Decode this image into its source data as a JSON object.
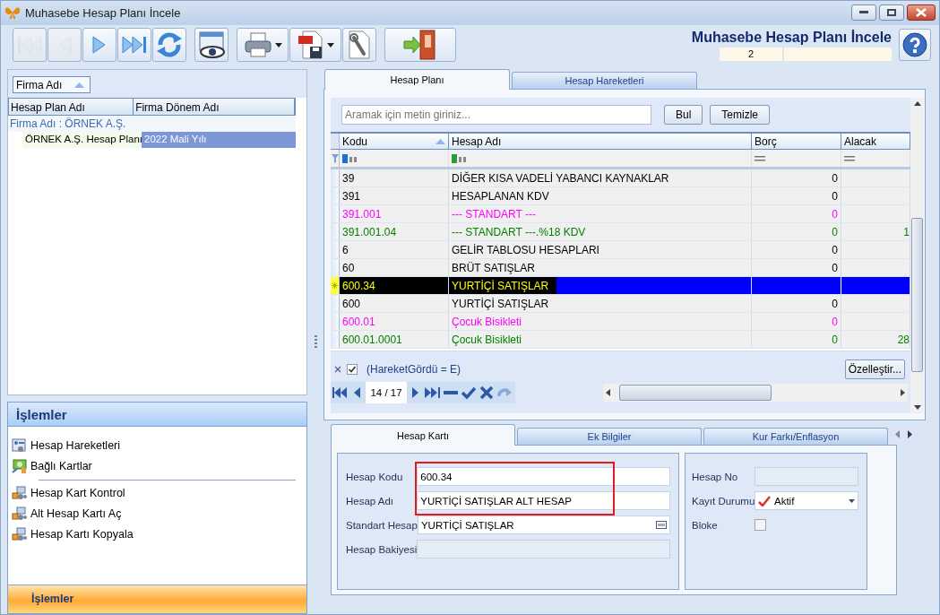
{
  "window": {
    "title": "Muhasebe Hesap Planı İncele"
  },
  "toolbar": [
    {
      "kind": "first",
      "disabled": true
    },
    {
      "kind": "prev",
      "disabled": true
    },
    {
      "kind": "next",
      "disabled": false
    },
    {
      "kind": "last",
      "disabled": false
    },
    {
      "kind": "refresh",
      "disabled": false
    },
    {
      "kind": "preview",
      "disabled": false
    },
    {
      "kind": "print",
      "disabled": false,
      "dropdown": true
    },
    {
      "kind": "pdf",
      "disabled": false,
      "dropdown": true
    },
    {
      "kind": "tools",
      "disabled": false
    },
    {
      "kind": "exit",
      "disabled": false
    }
  ],
  "header": {
    "title": "Muhasebe Hesap Planı İncele",
    "fields": [
      "2"
    ]
  },
  "plan_list": {
    "group_by": "Firma Adı",
    "columns": [
      "Hesap Plan Adı",
      "Firma Dönem Adı"
    ],
    "groups": [
      {
        "label": "Firma Adı : ÖRNEK A.Ş.",
        "children": [
          {
            "cells": [
              "ÖRNEK A.Ş. Hesap Planı",
              "2022 Mali Yılı"
            ],
            "selected": true
          }
        ]
      }
    ]
  },
  "tasks": {
    "title": "İşlemler",
    "items": [
      {
        "kind": "item",
        "label": "Hesap Hareketleri"
      },
      {
        "kind": "item",
        "label": "Bağlı Kartlar"
      },
      {
        "kind": "separator"
      },
      {
        "kind": "item",
        "label": "Hesap Kart Kontrol"
      },
      {
        "kind": "item",
        "label": "Alt Hesap Kartı Aç"
      },
      {
        "kind": "item",
        "label": "Hesap Kartı Kopyala"
      }
    ],
    "footer": "İşlemler"
  },
  "tabs": [
    {
      "label": "Hesap Planı",
      "selected": true
    },
    {
      "label": "Hesap Hareketleri",
      "selected": false
    }
  ],
  "search": {
    "placeholder": "Aramak için metin giriniz...",
    "buttons": [
      "Bul",
      "Temizle"
    ]
  },
  "grid": {
    "columns": [
      {
        "label": "Kodu",
        "sorted": true
      },
      {
        "label": "Hesap Adı",
        "sorted": false
      },
      {
        "label": "Borç",
        "sorted": false
      },
      {
        "label": "Alacak",
        "sorted": false
      }
    ],
    "rows": [
      {
        "code": "39",
        "name": "DİĞER KISA VADELİ YABANCI KAYNAKLAR",
        "debit": "0",
        "color": "#000000",
        "selected": false
      },
      {
        "code": "391",
        "name": "HESAPLANAN KDV",
        "debit": "0",
        "color": "#000000",
        "selected": false
      },
      {
        "code": "391.001",
        "name": "--- STANDART ---",
        "debit": "0",
        "color": "#ff00ff",
        "selected": false
      },
      {
        "code": "391.001.04",
        "name": "--- STANDART ---.%18 KDV",
        "debit": "0",
        "credit": "1",
        "color": "#008000",
        "selected": false
      },
      {
        "code": "6",
        "name": "GELİR TABLOSU HESAPLARI",
        "debit": "0",
        "color": "#000000",
        "selected": false
      },
      {
        "code": "60",
        "name": "BRÜT SATIŞLAR",
        "debit": "0",
        "color": "#000000",
        "selected": false
      },
      {
        "code": "600.34",
        "name": "YURTİÇİ SATIŞLAR",
        "color": "#000000",
        "selected": true
      },
      {
        "code": "600",
        "name": "YURTİÇİ SATIŞLAR",
        "debit": "0",
        "color": "#000000",
        "selected": false
      },
      {
        "code": "600.01",
        "name": "Çocuk Bisikleti",
        "debit": "0",
        "color": "#ff00ff",
        "selected": false
      },
      {
        "code": "600.01.0001",
        "name": "Çocuk Bisikleti",
        "debit": "0",
        "credit": "28",
        "color": "#008000",
        "selected": false
      }
    ],
    "filter": {
      "enabled": true,
      "text": "(HareketGördü = E)",
      "customize": "Özelleştir..."
    },
    "navigator": {
      "position": "14 / 17"
    }
  },
  "bottom_tabs": [
    {
      "label": "Hesap Kartı",
      "selected": true
    },
    {
      "label": "Ek Bilgiler",
      "selected": false
    },
    {
      "label": "Kur Farkı/Enflasyon",
      "selected": false
    }
  ],
  "form": {
    "left": [
      {
        "highlighted": true,
        "fields": [
          {
            "kind": "text",
            "label": "Hesap Kodu",
            "value": "600.34"
          },
          {
            "kind": "text",
            "label": "Hesap Adı",
            "value": "YURTİÇİ SATIŞLAR ALT HESAP"
          }
        ]
      },
      {
        "highlighted": false,
        "fields": [
          {
            "kind": "lookup",
            "label": "Standart Hesap",
            "value": "YURTİÇİ SATIŞLAR"
          },
          {
            "kind": "readonly",
            "label": "Hesap Bakiyesi"
          }
        ]
      }
    ],
    "right": [
      {
        "kind": "readonly",
        "label": "Hesap No"
      },
      {
        "kind": "combo",
        "label": "Kayıt Durumu",
        "value": "Aktif"
      },
      {
        "kind": "checkbox",
        "label": "Bloke",
        "checked": false
      }
    ]
  }
}
